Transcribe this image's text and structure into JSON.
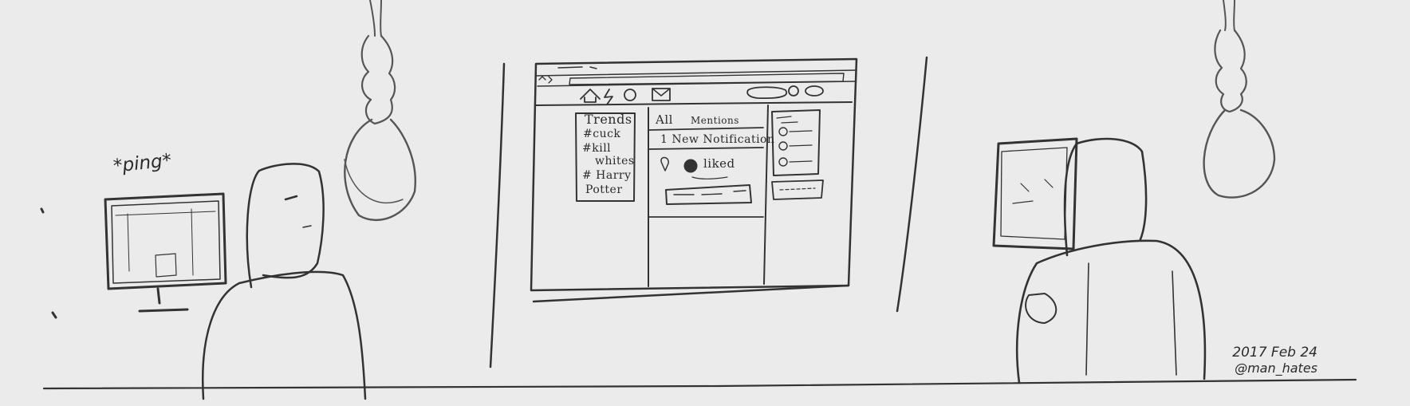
{
  "sound_effect": "*ping*",
  "browser_mockup": {
    "sidebar": {
      "title": "Trends",
      "items": [
        "#cuck",
        "#kill",
        "whites",
        "# Harry",
        "Potter"
      ]
    },
    "tabs": {
      "all": "All",
      "mentions": "Mentions"
    },
    "notification": "1 New Notification",
    "activity": "liked"
  },
  "signature": {
    "date": "2017 Feb 24",
    "handle": "@man_hates"
  },
  "colors": {
    "paper": "#ebebeb",
    "pencil": "#2b2b2b"
  }
}
